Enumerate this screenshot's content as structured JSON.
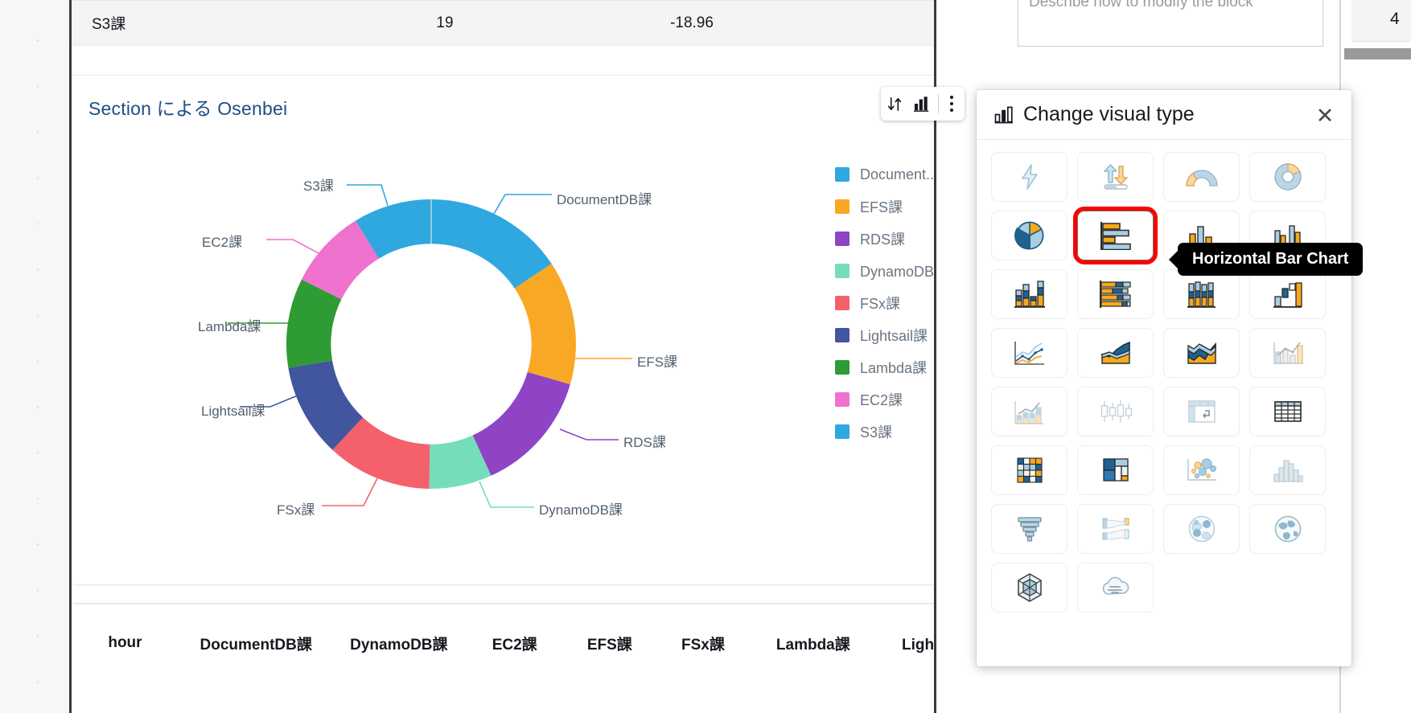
{
  "top_table": {
    "row": {
      "section": "S3課",
      "count": "19",
      "value": "-18.96"
    }
  },
  "visual": {
    "title": "Section による Osenbei",
    "toolbar": {
      "sort_icon": "sort-icon",
      "chart_icon": "bar-chart-icon",
      "menu_icon": "kebab-menu-icon"
    }
  },
  "chart_data": {
    "type": "pie",
    "title": "Section による Osenbei",
    "subtype": "donut",
    "legend_position": "right",
    "labels": [
      "DocumentDB課",
      "EFS課",
      "RDS課",
      "DynamoDB課",
      "FSx課",
      "Lightsail課",
      "Lambda課",
      "EC2課",
      "S3課"
    ],
    "values": [
      12.2,
      13.5,
      12.8,
      10.5,
      9.6,
      10.8,
      10.0,
      9.3,
      11.3
    ],
    "colors": [
      "#2eA8DE",
      "#F9A825",
      "#8E44C4",
      "#76DDBA",
      "#F4606C",
      "#41569E",
      "#2E9B34",
      "#EE72CE",
      "#2EA8DE"
    ],
    "callout_labels": [
      "DocumentDB課",
      "EFS課",
      "RDS課",
      "DynamoDB課",
      "FSx課",
      "Lightsail課",
      "Lambda課",
      "EC2課",
      "S3課"
    ]
  },
  "legend": {
    "items": [
      {
        "label": "Document...",
        "color": "#2EA8DE"
      },
      {
        "label": "EFS課",
        "color": "#F9A825"
      },
      {
        "label": "RDS課",
        "color": "#8E44C4"
      },
      {
        "label": "DynamoDB課",
        "color": "#76DDBA"
      },
      {
        "label": "FSx課",
        "color": "#F4606C"
      },
      {
        "label": "Lightsail課",
        "color": "#41569E"
      },
      {
        "label": "Lambda課",
        "color": "#2E9B34"
      },
      {
        "label": "EC2課",
        "color": "#EE72CE"
      },
      {
        "label": "S3課",
        "color": "#2EA8DE"
      }
    ]
  },
  "bottom_table": {
    "headers": [
      "hour",
      "DocumentDB課",
      "DynamoDB課",
      "EC2課",
      "EFS課",
      "FSx課",
      "Lambda課",
      "Lightsail課"
    ]
  },
  "right_panel": {
    "describe_placeholder": "Describe how to modify the block",
    "cell_number": "4"
  },
  "visual_type_popover": {
    "title": "Change visual type",
    "close_label": "✕",
    "tooltip": "Horizontal Bar Chart",
    "icons": [
      "autograph-icon",
      "kpi-icon",
      "gauge-chart-icon",
      "donut-chart-icon",
      "pie-chart-icon",
      "horizontal-bar-chart-icon",
      "vertical-bar-chart-icon",
      "clustered-bar-chart-icon",
      "stacked-vertical-bar-icon",
      "stacked-horizontal-bar-icon",
      "clustered-column-icon",
      "waterfall-chart-icon",
      "line-chart-icon",
      "area-chart-icon",
      "stacked-area-chart-icon",
      "combo-chart-icon",
      "line-bar-combo-icon",
      "box-plot-icon",
      "pivot-table-icon",
      "table-icon",
      "heat-map-icon",
      "tree-map-icon",
      "scatter-plot-icon",
      "histogram-icon",
      "funnel-chart-icon",
      "sankey-diagram-icon",
      "points-on-map-icon",
      "filled-map-icon",
      "radar-chart-icon",
      "word-cloud-icon"
    ],
    "selected_index": 5
  }
}
